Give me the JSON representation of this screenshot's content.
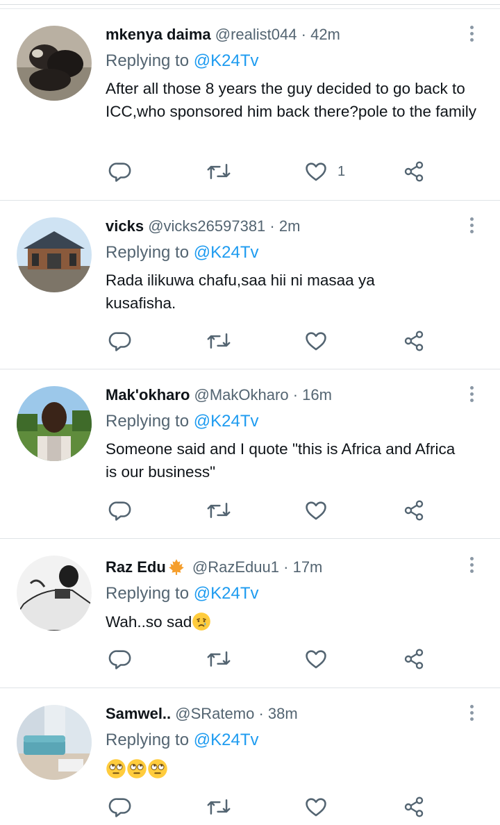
{
  "tweets": [
    {
      "name": "mkenya daima",
      "handle": "@realist044",
      "time": "42m",
      "reply_prefix": "Replying to",
      "reply_to": "@K24Tv",
      "text": "After all those 8 years the guy decided to go back to ICC,who sponsored him back there?pole to the family",
      "likes": "1"
    },
    {
      "name": "vicks",
      "handle": "@vicks26597381",
      "time": "2m",
      "reply_prefix": "Replying to",
      "reply_to": "@K24Tv",
      "text": "Rada ilikuwa chafu,saa hii ni masaa ya kusafisha.",
      "likes": ""
    },
    {
      "name": "Mak'okharo",
      "handle": "@MakOkharo",
      "time": "16m",
      "reply_prefix": "Replying to",
      "reply_to": "@K24Tv",
      "text": "Someone said and I quote \"this is Africa and Africa is our business\"",
      "likes": ""
    },
    {
      "name": "Raz Edu",
      "handle": "@RazEduu1",
      "time": "17m",
      "reply_prefix": "Replying to",
      "reply_to": "@K24Tv",
      "text": "Wah..so sad",
      "likes": ""
    },
    {
      "name": "Samwel..",
      "handle": "@SRatemo",
      "time": "38m",
      "reply_prefix": "Replying to",
      "reply_to": "@K24Tv",
      "text": "",
      "likes": ""
    }
  ],
  "separator": "·",
  "icons": {
    "reply": "reply-icon",
    "retweet": "retweet-icon",
    "like": "heart-icon",
    "share": "share-icon",
    "more": "more-vertical-icon",
    "name_badge_tweet4": "maple-leaf-emoji",
    "text_emoji_tweet4": "crying-face-emoji",
    "text_emoji_tweet5": "face-with-rolling-eyes-emoji x3"
  },
  "colors": {
    "mention": "#1d9bf0",
    "secondary_text": "#536471",
    "primary_text": "#0f1419",
    "divider": "#dfe3e6"
  }
}
